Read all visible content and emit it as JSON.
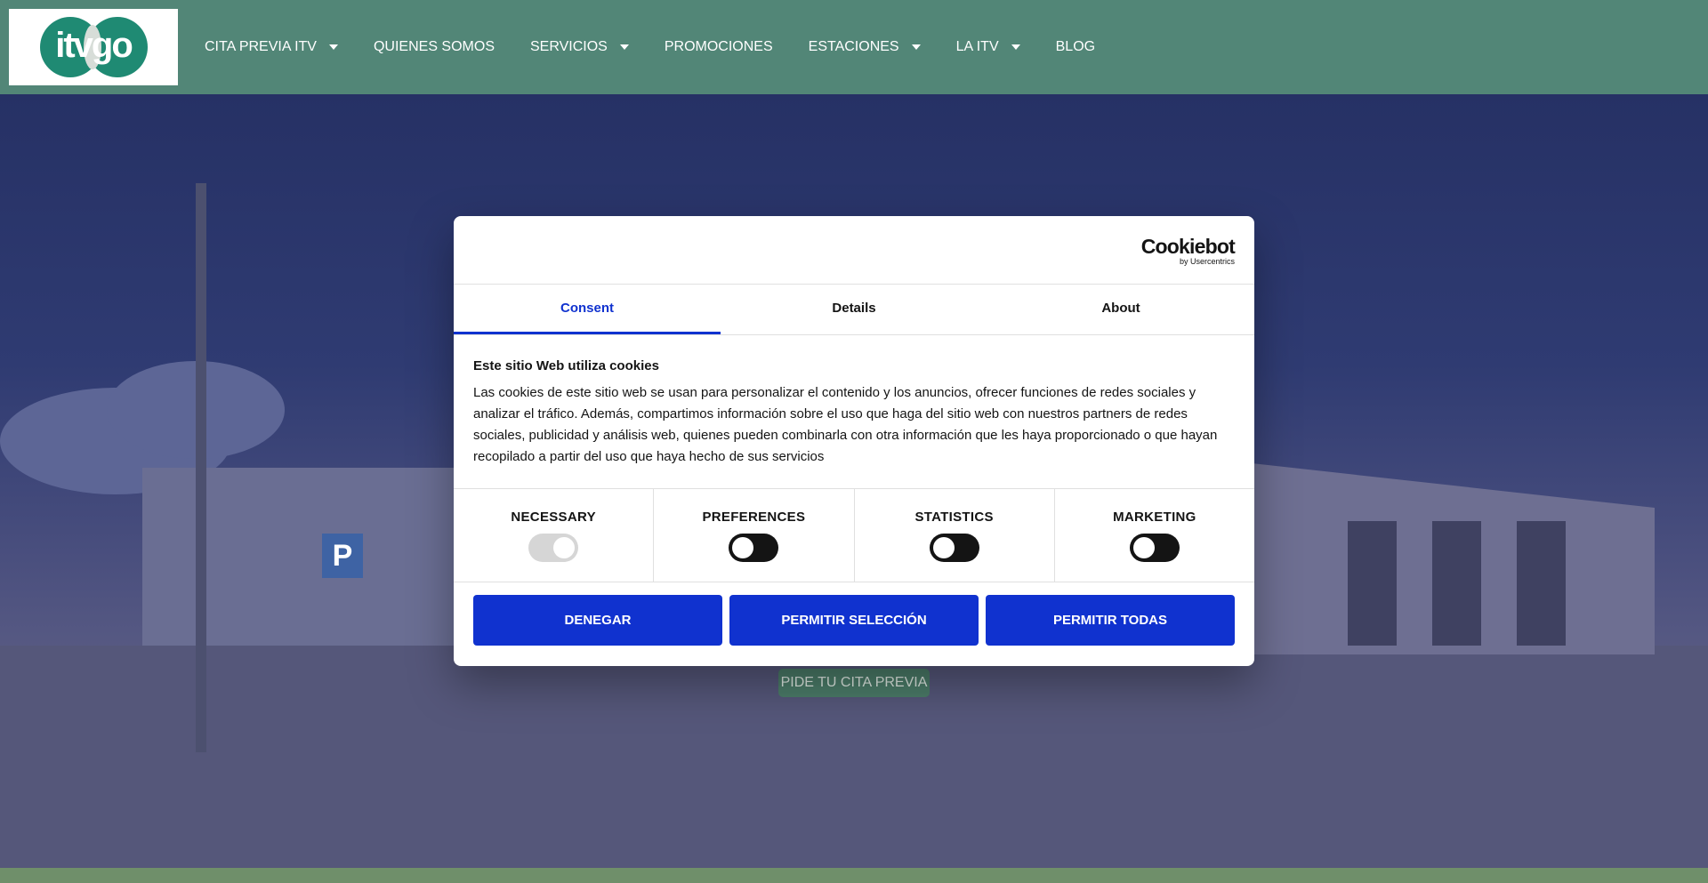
{
  "header": {
    "logo_text": "itvgo",
    "nav": [
      {
        "label": "CITA PREVIA ITV",
        "has_dropdown": true
      },
      {
        "label": "QUIENES SOMOS",
        "has_dropdown": false
      },
      {
        "label": "SERVICIOS",
        "has_dropdown": true
      },
      {
        "label": "PROMOCIONES",
        "has_dropdown": false
      },
      {
        "label": "ESTACIONES",
        "has_dropdown": true
      },
      {
        "label": "LA ITV",
        "has_dropdown": true
      },
      {
        "label": "BLOG",
        "has_dropdown": false
      }
    ]
  },
  "hero": {
    "parking_sign": "P",
    "cta_label": "PIDE TU CITA PREVIA"
  },
  "cookie_dialog": {
    "brand_name": "Cookiebot",
    "brand_by": "by Usercentrics",
    "tabs": [
      {
        "label": "Consent",
        "active": true
      },
      {
        "label": "Details",
        "active": false
      },
      {
        "label": "About",
        "active": false
      }
    ],
    "title": "Este sitio Web utiliza cookies",
    "body": "Las cookies de este sitio web se usan para personalizar el contenido y los anuncios, ofrecer funciones de redes sociales y analizar el tráfico. Además, compartimos información sobre el uso que haga del sitio web con nuestros partners de redes sociales, publicidad y análisis web, quienes pueden combinarla con otra información que les haya proporcionado o que hayan recopilado a partir del uso que haya hecho de sus servicios",
    "toggles": [
      {
        "label": "NECESSARY",
        "enabled": true,
        "locked": true
      },
      {
        "label": "PREFERENCES",
        "enabled": false,
        "locked": false
      },
      {
        "label": "STATISTICS",
        "enabled": false,
        "locked": false
      },
      {
        "label": "MARKETING",
        "enabled": false,
        "locked": false
      }
    ],
    "buttons": {
      "deny": "DENEGAR",
      "allow_selection": "PERMITIR SELECCIÓN",
      "allow_all": "PERMITIR TODAS"
    }
  },
  "colors": {
    "header_bg": "#528677",
    "accent_blue": "#1032cf",
    "cta_green": "#4b7c69"
  }
}
